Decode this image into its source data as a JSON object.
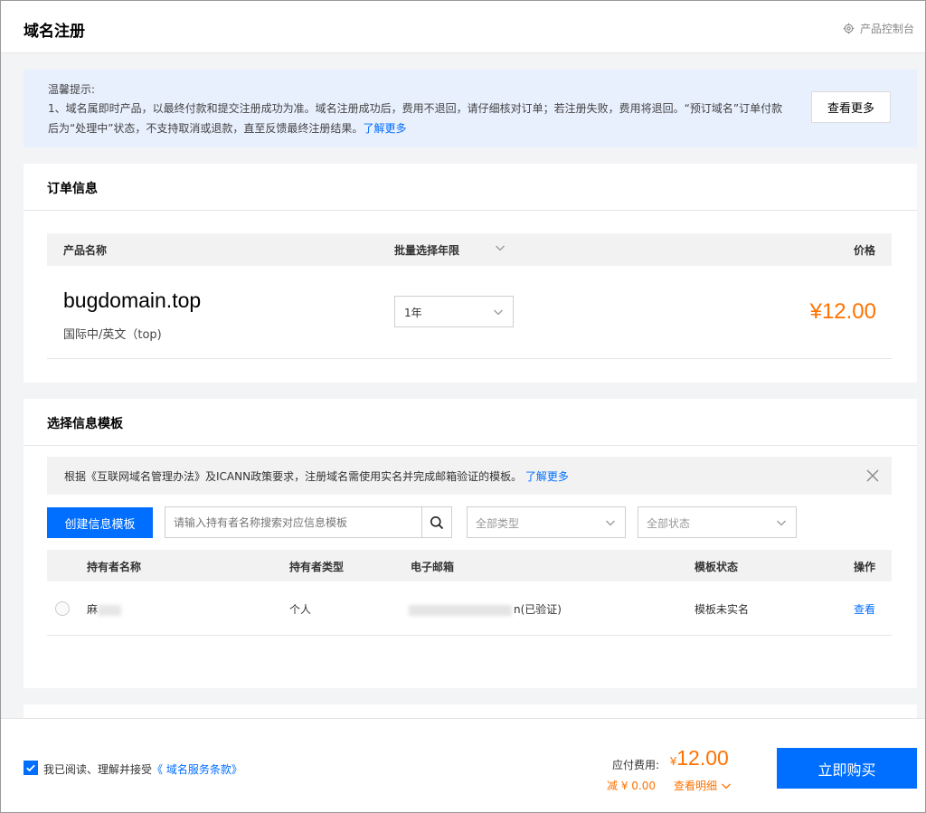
{
  "header": {
    "title": "域名注册",
    "console_link": "产品控制台"
  },
  "notice": {
    "title": "温馨提示:",
    "text": "1、域名属即时产品，以最终付款和提交注册成功为准。域名注册成功后，费用不退回，请仔细核对订单；若注册失败，费用将退回。“预订域名”订单付款后为“处理中”状态，不支持取消或退款，直至反馈最终注册结果。",
    "learn_more": "了解更多",
    "more_button": "查看更多"
  },
  "order": {
    "title": "订单信息",
    "columns": {
      "product": "产品名称",
      "period": "批量选择年限",
      "price": "价格"
    },
    "item": {
      "domain": "bugdomain.top",
      "subtitle": "国际中/英文（top)",
      "period": "1年",
      "price": "¥12.00"
    }
  },
  "template": {
    "title": "选择信息模板",
    "policy_text": "根据《互联网域名管理办法》及ICANN政策要求，注册域名需使用实名并完成邮箱验证的模板。",
    "policy_link": "了解更多",
    "create_button": "创建信息模板",
    "search_placeholder": "请输入持有者名称搜索对应信息模板",
    "type_filter": "全部类型",
    "status_filter": "全部状态",
    "columns": {
      "holder": "持有者名称",
      "type": "持有者类型",
      "email": "电子邮箱",
      "status": "模板状态",
      "action": "操作"
    },
    "rows": [
      {
        "holder": "麻",
        "type": "个人",
        "email_suffix": "n(已验证)",
        "status": "模板未实名",
        "action": "查看"
      }
    ]
  },
  "footer": {
    "agree_text": "我已阅读、理解并接受",
    "terms_link": "《 域名服务条款》",
    "fee_label": "应付费用:",
    "fee_currency": "¥",
    "fee_value": "12.00",
    "discount": "减 ¥ 0.00",
    "detail_link": "查看明细",
    "buy_button": "立即购买"
  },
  "colors": {
    "primary": "#006eff",
    "price": "#ff7200",
    "notice_bg": "#e8effd"
  }
}
